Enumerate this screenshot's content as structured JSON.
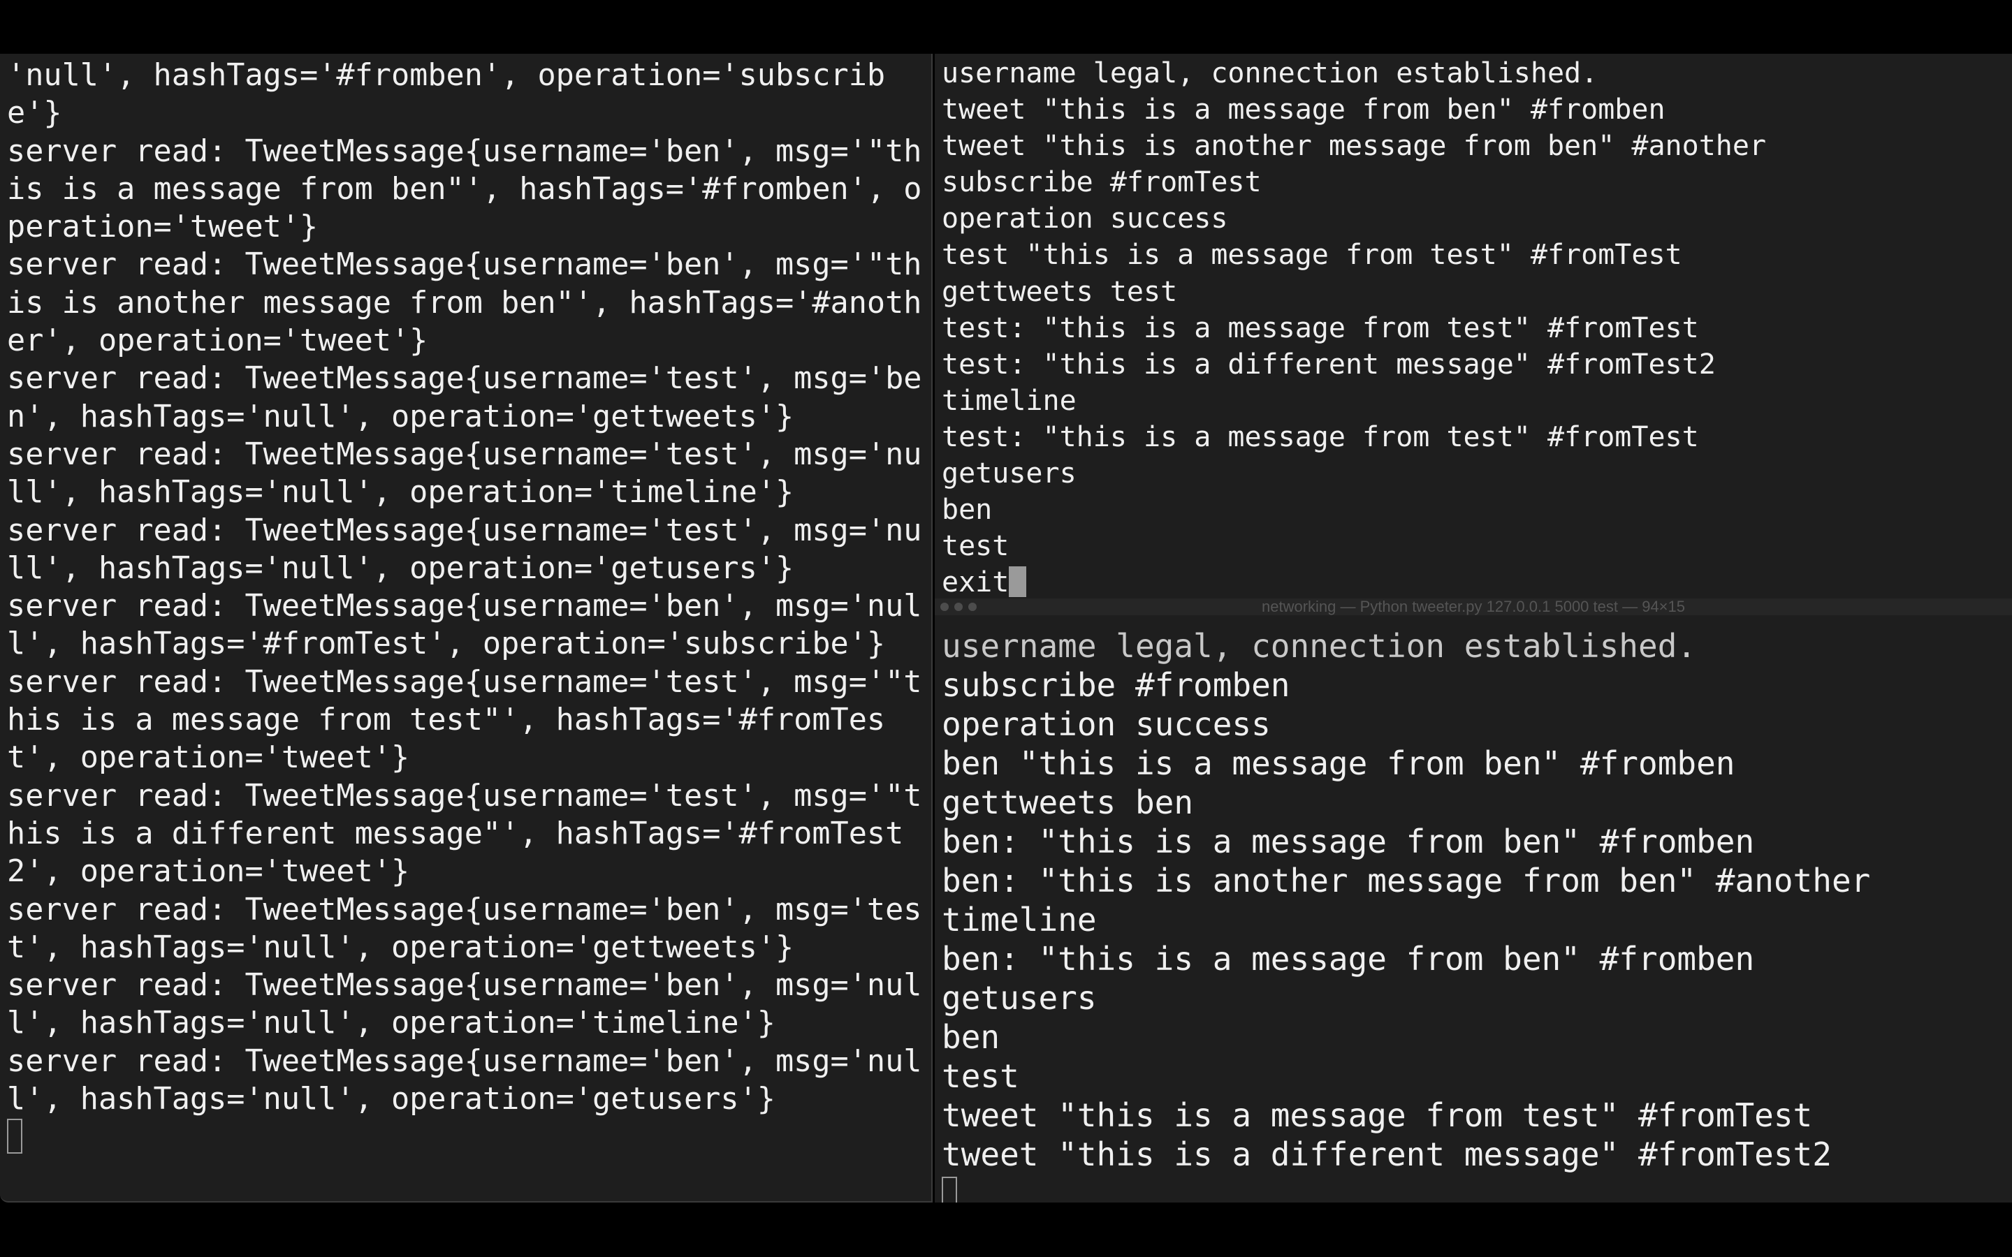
{
  "left_terminal": {
    "lines": [
      "'null', hashTags='#fromben', operation='subscribe'}",
      "server read: TweetMessage{username='ben', msg='\"this is a message from ben\"', hashTags='#fromben', operation='tweet'}",
      "server read: TweetMessage{username='ben', msg='\"this is another message from ben\"', hashTags='#another', operation='tweet'}",
      "server read: TweetMessage{username='test', msg='ben', hashTags='null', operation='gettweets'}",
      "server read: TweetMessage{username='test', msg='null', hashTags='null', operation='timeline'}",
      "server read: TweetMessage{username='test', msg='null', hashTags='null', operation='getusers'}",
      "server read: TweetMessage{username='ben', msg='null', hashTags='#fromTest', operation='subscribe'}",
      "server read: TweetMessage{username='test', msg='\"this is a message from test\"', hashTags='#fromTest', operation='tweet'}",
      "server read: TweetMessage{username='test', msg='\"this is a different message\"', hashTags='#fromTest2', operation='tweet'}",
      "server read: TweetMessage{username='ben', msg='test', hashTags='null', operation='gettweets'}",
      "server read: TweetMessage{username='ben', msg='null', hashTags='null', operation='timeline'}",
      "server read: TweetMessage{username='ben', msg='null', hashTags='null', operation='getusers'}"
    ]
  },
  "top_right_terminal": {
    "lines": [
      "username legal, connection established.",
      "tweet \"this is a message from ben\" #fromben",
      "tweet \"this is another message from ben\" #another",
      "subscribe #fromTest",
      "operation success",
      "test \"this is a message from test\" #fromTest",
      "gettweets test",
      "test: \"this is a message from test\" #fromTest",
      "test: \"this is a different message\" #fromTest2",
      "timeline",
      "test: \"this is a message from test\" #fromTest",
      "getusers",
      "ben",
      "test"
    ],
    "input_line": "exit"
  },
  "bottom_right_terminal": {
    "title": "networking — Python tweeter.py 127.0.0.1 5000 test — 94×15",
    "lines": [
      "username legal, connection established.",
      "subscribe #fromben",
      "operation success",
      "ben \"this is a message from ben\" #fromben",
      "gettweets ben",
      "ben: \"this is a message from ben\" #fromben",
      "ben: \"this is another message from ben\" #another",
      "timeline",
      "ben: \"this is a message from ben\" #fromben",
      "getusers",
      "ben",
      "test",
      "tweet \"this is a message from test\" #fromTest",
      "tweet \"this is a different message\" #fromTest2"
    ]
  },
  "colors": {
    "terminal_background": "#1e1e1e",
    "text": "#f0f0f0",
    "cursor": "#9a9a9a",
    "desktop": "#000000"
  }
}
